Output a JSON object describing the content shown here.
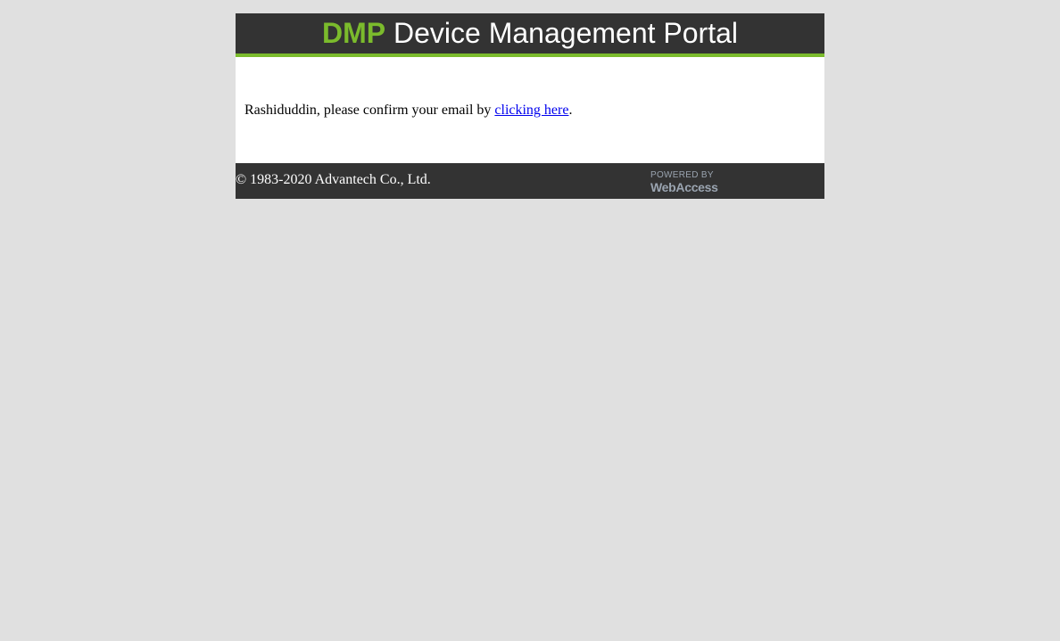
{
  "header": {
    "brand": "DMP",
    "title": " Device Management Portal"
  },
  "body": {
    "message_prefix": "Rashiduddin, please confirm your email by ",
    "link_text": "clicking here",
    "message_suffix": "."
  },
  "footer": {
    "copyright": "© 1983-2020 Advantech Co., Ltd.",
    "powered_by_top": "POWERED BY",
    "powered_by_brand": "WebAccess"
  },
  "colors": {
    "page_background": "#e0e0e0",
    "header_background": "#333333",
    "accent_green": "#7bbb2c",
    "link": "#0000ee",
    "logo_gray": "#9aa4b0"
  }
}
